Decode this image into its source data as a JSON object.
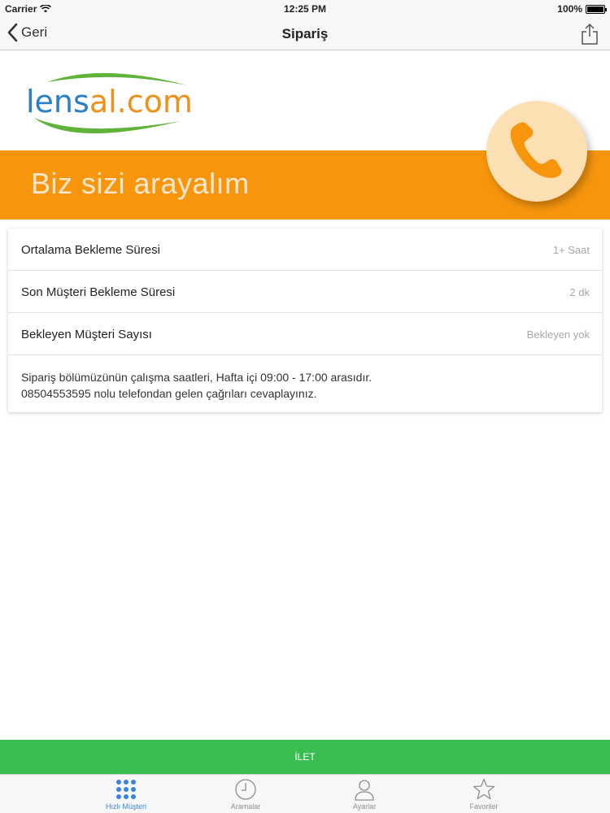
{
  "status_bar": {
    "carrier": "Carrier",
    "time": "12:25 PM",
    "battery": "100%"
  },
  "nav": {
    "back_label": "Geri",
    "title": "Sipariş"
  },
  "logo": {
    "text_part1": "lens",
    "text_part2": "al.com",
    "color_blue": "#2b7fc6",
    "color_orange": "#f0901a",
    "color_green": "#5fb33a"
  },
  "banner": {
    "text": "Biz sizi arayalım",
    "color": "#f7960d"
  },
  "info": {
    "rows": [
      {
        "label": "Ortalama Bekleme Süresi",
        "value": "1+ Saat"
      },
      {
        "label": "Son Müşteri Bekleme Süresi",
        "value": "2 dk"
      },
      {
        "label": "Bekleyen Müşteri Sayısı",
        "value": "Bekleyen yok"
      }
    ],
    "note_line1": "Sipariş bölümüzünün çalışma saatleri, Hafta içi 09:00 - 17:00 arasıdır.",
    "note_line2": "08504553595 nolu telefondan gelen çağrıları cevaplayınız."
  },
  "forward_button": {
    "label": "İLET",
    "color": "#39bd51"
  },
  "tabs": [
    {
      "label": "Hızlı Müşteri",
      "icon": "grid-icon",
      "active": true
    },
    {
      "label": "Aramalar",
      "icon": "clock-icon",
      "active": false
    },
    {
      "label": "Ayarlar",
      "icon": "person-icon",
      "active": false
    },
    {
      "label": "Favoriler",
      "icon": "star-icon",
      "active": false
    }
  ]
}
